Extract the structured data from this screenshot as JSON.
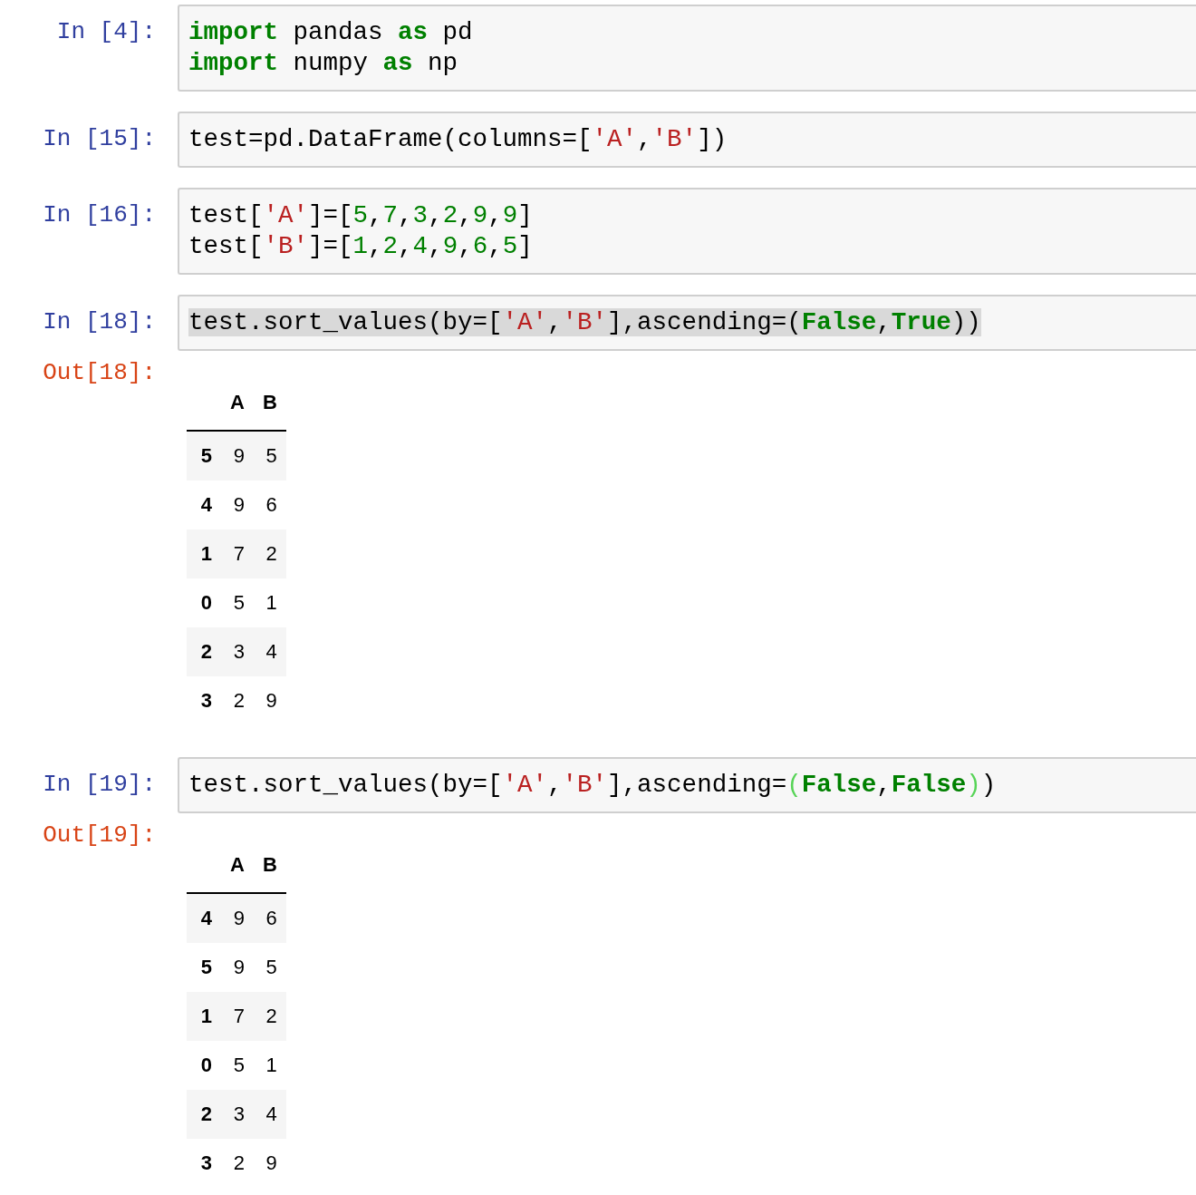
{
  "cells": [
    {
      "prompt": "In [4]:",
      "lines": [
        {
          "selected": false,
          "tokens": [
            {
              "kind": "keyword",
              "text": "import"
            },
            {
              "kind": "plain",
              "text": " pandas "
            },
            {
              "kind": "keyword",
              "text": "as"
            },
            {
              "kind": "plain",
              "text": " pd"
            }
          ]
        },
        {
          "selected": false,
          "tokens": [
            {
              "kind": "keyword",
              "text": "import"
            },
            {
              "kind": "plain",
              "text": " numpy "
            },
            {
              "kind": "keyword",
              "text": "as"
            },
            {
              "kind": "plain",
              "text": " np"
            }
          ]
        }
      ]
    },
    {
      "prompt": "In [15]:",
      "lines": [
        {
          "selected": false,
          "tokens": [
            {
              "kind": "plain",
              "text": "test=pd.DataFrame(columns=["
            },
            {
              "kind": "string",
              "text": "'A'"
            },
            {
              "kind": "plain",
              "text": ","
            },
            {
              "kind": "string",
              "text": "'B'"
            },
            {
              "kind": "plain",
              "text": "])"
            }
          ]
        }
      ]
    },
    {
      "prompt": "In [16]:",
      "lines": [
        {
          "selected": false,
          "tokens": [
            {
              "kind": "plain",
              "text": "test["
            },
            {
              "kind": "string",
              "text": "'A'"
            },
            {
              "kind": "plain",
              "text": "]=["
            },
            {
              "kind": "number",
              "text": "5"
            },
            {
              "kind": "plain",
              "text": ","
            },
            {
              "kind": "number",
              "text": "7"
            },
            {
              "kind": "plain",
              "text": ","
            },
            {
              "kind": "number",
              "text": "3"
            },
            {
              "kind": "plain",
              "text": ","
            },
            {
              "kind": "number",
              "text": "2"
            },
            {
              "kind": "plain",
              "text": ","
            },
            {
              "kind": "number",
              "text": "9"
            },
            {
              "kind": "plain",
              "text": ","
            },
            {
              "kind": "number",
              "text": "9"
            },
            {
              "kind": "plain",
              "text": "]"
            }
          ]
        },
        {
          "selected": false,
          "tokens": [
            {
              "kind": "plain",
              "text": "test["
            },
            {
              "kind": "string",
              "text": "'B'"
            },
            {
              "kind": "plain",
              "text": "]=["
            },
            {
              "kind": "number",
              "text": "1"
            },
            {
              "kind": "plain",
              "text": ","
            },
            {
              "kind": "number",
              "text": "2"
            },
            {
              "kind": "plain",
              "text": ","
            },
            {
              "kind": "number",
              "text": "4"
            },
            {
              "kind": "plain",
              "text": ","
            },
            {
              "kind": "number",
              "text": "9"
            },
            {
              "kind": "plain",
              "text": ","
            },
            {
              "kind": "number",
              "text": "6"
            },
            {
              "kind": "plain",
              "text": ","
            },
            {
              "kind": "number",
              "text": "5"
            },
            {
              "kind": "plain",
              "text": "]"
            }
          ]
        }
      ]
    },
    {
      "prompt": "In [18]:",
      "lines": [
        {
          "selected": true,
          "tokens": [
            {
              "kind": "plain",
              "text": "test.sort_values(by=["
            },
            {
              "kind": "string",
              "text": "'A'"
            },
            {
              "kind": "plain",
              "text": ","
            },
            {
              "kind": "string",
              "text": "'B'"
            },
            {
              "kind": "plain",
              "text": "],ascending=("
            },
            {
              "kind": "keyword",
              "text": "False"
            },
            {
              "kind": "plain",
              "text": ","
            },
            {
              "kind": "keyword",
              "text": "True"
            },
            {
              "kind": "plain",
              "text": "))"
            }
          ]
        }
      ],
      "output": {
        "prompt": "Out[18]:",
        "table": {
          "columns": [
            "A",
            "B"
          ],
          "rows": [
            {
              "index": "5",
              "cells": [
                "9",
                "5"
              ]
            },
            {
              "index": "4",
              "cells": [
                "9",
                "6"
              ]
            },
            {
              "index": "1",
              "cells": [
                "7",
                "2"
              ]
            },
            {
              "index": "0",
              "cells": [
                "5",
                "1"
              ]
            },
            {
              "index": "2",
              "cells": [
                "3",
                "4"
              ]
            },
            {
              "index": "3",
              "cells": [
                "2",
                "9"
              ]
            }
          ]
        }
      }
    },
    {
      "prompt": "In [19]:",
      "lines": [
        {
          "selected": false,
          "tokens": [
            {
              "kind": "plain",
              "text": "test.sort_values(by=["
            },
            {
              "kind": "string",
              "text": "'A'"
            },
            {
              "kind": "plain",
              "text": ","
            },
            {
              "kind": "string",
              "text": "'B'"
            },
            {
              "kind": "plain",
              "text": "],ascending="
            },
            {
              "kind": "matched_bracket",
              "text": "("
            },
            {
              "kind": "keyword",
              "text": "False"
            },
            {
              "kind": "plain",
              "text": ","
            },
            {
              "kind": "keyword",
              "text": "False"
            },
            {
              "kind": "matched_bracket",
              "text": ")"
            },
            {
              "kind": "plain",
              "text": ")"
            }
          ]
        }
      ],
      "output": {
        "prompt": "Out[19]:",
        "table": {
          "columns": [
            "A",
            "B"
          ],
          "rows": [
            {
              "index": "4",
              "cells": [
                "9",
                "6"
              ]
            },
            {
              "index": "5",
              "cells": [
                "9",
                "5"
              ]
            },
            {
              "index": "1",
              "cells": [
                "7",
                "2"
              ]
            },
            {
              "index": "0",
              "cells": [
                "5",
                "1"
              ]
            },
            {
              "index": "2",
              "cells": [
                "3",
                "4"
              ]
            },
            {
              "index": "3",
              "cells": [
                "2",
                "9"
              ]
            }
          ]
        }
      }
    }
  ]
}
